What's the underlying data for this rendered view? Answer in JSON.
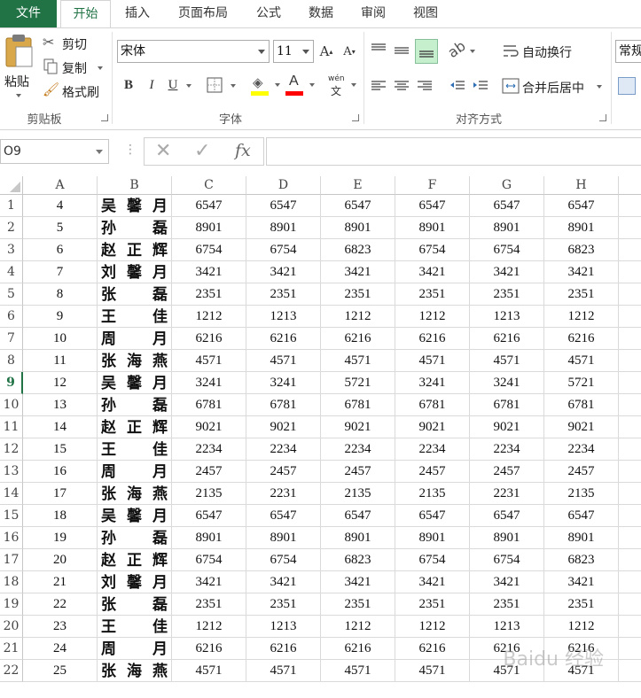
{
  "tabs": [
    {
      "label": "文件",
      "key": "file"
    },
    {
      "label": "开始",
      "key": "home"
    },
    {
      "label": "插入",
      "key": "insert"
    },
    {
      "label": "页面布局",
      "key": "layout"
    },
    {
      "label": "公式",
      "key": "formulas"
    },
    {
      "label": "数据",
      "key": "data"
    },
    {
      "label": "审阅",
      "key": "review"
    },
    {
      "label": "视图",
      "key": "view"
    }
  ],
  "ribbon": {
    "clipboard": {
      "paste": "粘贴",
      "cut": "剪切",
      "copy": "复制",
      "format_painter": "格式刷",
      "group_label": "剪贴板"
    },
    "font": {
      "name": "宋体",
      "size": "11",
      "bold": "B",
      "italic": "I",
      "underline": "U",
      "font_color_letter": "A",
      "phonetic_top": "wén",
      "phonetic_bottom": "文",
      "group_label": "字体"
    },
    "alignment": {
      "wrap_text": "自动换行",
      "merge_center": "合并后居中",
      "group_label": "对齐方式"
    },
    "number": {
      "format": "常规"
    }
  },
  "formula_bar": {
    "name_box": "O9",
    "fx": "fx",
    "formula": ""
  },
  "colors": {
    "accent": "#217346",
    "fill_yellow": "#ffff00",
    "font_red": "#ff0000"
  },
  "columns": [
    "A",
    "B",
    "C",
    "D",
    "E",
    "F",
    "G",
    "H"
  ],
  "rows": [
    {
      "n": "1",
      "a": "4",
      "b": [
        "吴",
        "馨",
        "月"
      ],
      "v": [
        "6547",
        "6547",
        "6547",
        "6547",
        "6547",
        "6547"
      ]
    },
    {
      "n": "2",
      "a": "5",
      "b": [
        "孙",
        "磊"
      ],
      "v": [
        "8901",
        "8901",
        "8901",
        "8901",
        "8901",
        "8901"
      ]
    },
    {
      "n": "3",
      "a": "6",
      "b": [
        "赵",
        "正",
        "辉"
      ],
      "v": [
        "6754",
        "6754",
        "6823",
        "6754",
        "6754",
        "6823"
      ]
    },
    {
      "n": "4",
      "a": "7",
      "b": [
        "刘",
        "馨",
        "月"
      ],
      "v": [
        "3421",
        "3421",
        "3421",
        "3421",
        "3421",
        "3421"
      ]
    },
    {
      "n": "5",
      "a": "8",
      "b": [
        "张",
        "磊"
      ],
      "v": [
        "2351",
        "2351",
        "2351",
        "2351",
        "2351",
        "2351"
      ]
    },
    {
      "n": "6",
      "a": "9",
      "b": [
        "王",
        "佳"
      ],
      "v": [
        "1212",
        "1213",
        "1212",
        "1212",
        "1213",
        "1212"
      ]
    },
    {
      "n": "7",
      "a": "10",
      "b": [
        "周",
        "月"
      ],
      "v": [
        "6216",
        "6216",
        "6216",
        "6216",
        "6216",
        "6216"
      ]
    },
    {
      "n": "8",
      "a": "11",
      "b": [
        "张",
        "海",
        "燕"
      ],
      "v": [
        "4571",
        "4571",
        "4571",
        "4571",
        "4571",
        "4571"
      ]
    },
    {
      "n": "9",
      "a": "12",
      "b": [
        "吴",
        "馨",
        "月"
      ],
      "v": [
        "3241",
        "3241",
        "5721",
        "3241",
        "3241",
        "5721"
      ]
    },
    {
      "n": "10",
      "a": "13",
      "b": [
        "孙",
        "磊"
      ],
      "v": [
        "6781",
        "6781",
        "6781",
        "6781",
        "6781",
        "6781"
      ]
    },
    {
      "n": "11",
      "a": "14",
      "b": [
        "赵",
        "正",
        "辉"
      ],
      "v": [
        "9021",
        "9021",
        "9021",
        "9021",
        "9021",
        "9021"
      ]
    },
    {
      "n": "12",
      "a": "15",
      "b": [
        "王",
        "佳"
      ],
      "v": [
        "2234",
        "2234",
        "2234",
        "2234",
        "2234",
        "2234"
      ]
    },
    {
      "n": "13",
      "a": "16",
      "b": [
        "周",
        "月"
      ],
      "v": [
        "2457",
        "2457",
        "2457",
        "2457",
        "2457",
        "2457"
      ]
    },
    {
      "n": "14",
      "a": "17",
      "b": [
        "张",
        "海",
        "燕"
      ],
      "v": [
        "2135",
        "2231",
        "2135",
        "2135",
        "2231",
        "2135"
      ]
    },
    {
      "n": "15",
      "a": "18",
      "b": [
        "吴",
        "馨",
        "月"
      ],
      "v": [
        "6547",
        "6547",
        "6547",
        "6547",
        "6547",
        "6547"
      ]
    },
    {
      "n": "16",
      "a": "19",
      "b": [
        "孙",
        "磊"
      ],
      "v": [
        "8901",
        "8901",
        "8901",
        "8901",
        "8901",
        "8901"
      ]
    },
    {
      "n": "17",
      "a": "20",
      "b": [
        "赵",
        "正",
        "辉"
      ],
      "v": [
        "6754",
        "6754",
        "6823",
        "6754",
        "6754",
        "6823"
      ]
    },
    {
      "n": "18",
      "a": "21",
      "b": [
        "刘",
        "馨",
        "月"
      ],
      "v": [
        "3421",
        "3421",
        "3421",
        "3421",
        "3421",
        "3421"
      ]
    },
    {
      "n": "19",
      "a": "22",
      "b": [
        "张",
        "磊"
      ],
      "v": [
        "2351",
        "2351",
        "2351",
        "2351",
        "2351",
        "2351"
      ]
    },
    {
      "n": "20",
      "a": "23",
      "b": [
        "王",
        "佳"
      ],
      "v": [
        "1212",
        "1213",
        "1212",
        "1212",
        "1213",
        "1212"
      ]
    },
    {
      "n": "21",
      "a": "24",
      "b": [
        "周",
        "月"
      ],
      "v": [
        "6216",
        "6216",
        "6216",
        "6216",
        "6216",
        "6216"
      ]
    },
    {
      "n": "22",
      "a": "25",
      "b": [
        "张",
        "海",
        "燕"
      ],
      "v": [
        "4571",
        "4571",
        "4571",
        "4571",
        "4571",
        "4571"
      ]
    }
  ],
  "selected_row": "9",
  "watermark": "Baidu 经验"
}
